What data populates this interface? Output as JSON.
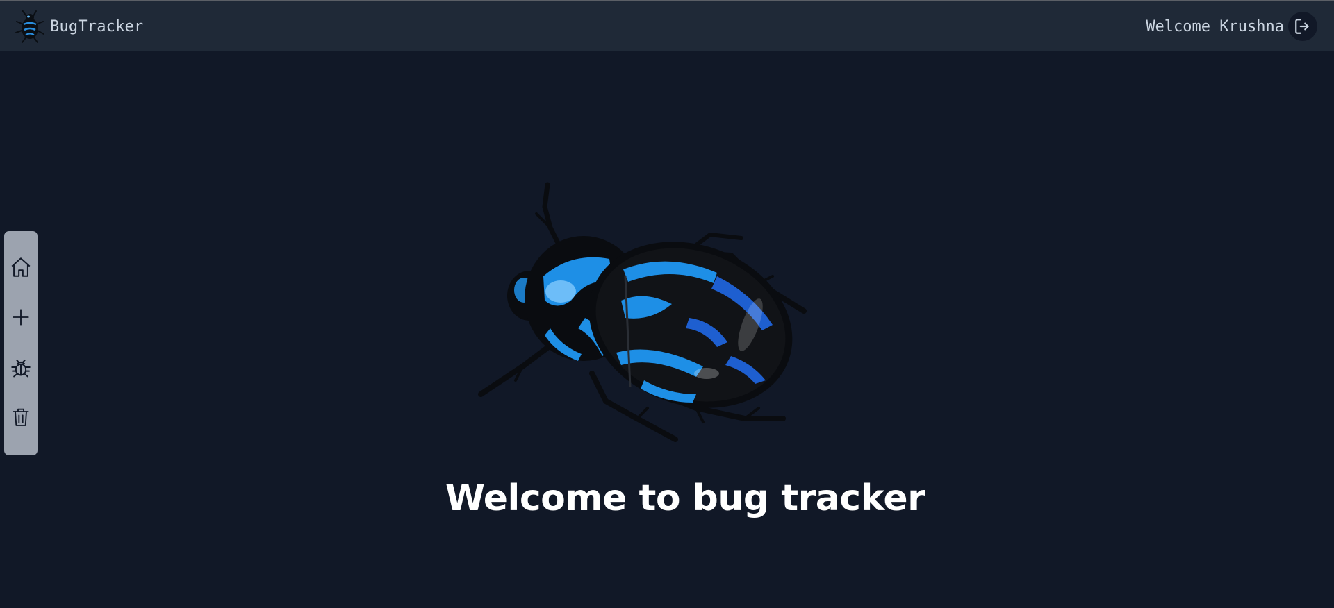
{
  "app": {
    "name": "BugTracker",
    "logo_icon": "beetle-logo-icon"
  },
  "header": {
    "welcome_text": "Welcome Krushna",
    "logout_icon": "logout-icon"
  },
  "sidebar": {
    "items": [
      {
        "id": "home",
        "icon": "home-icon"
      },
      {
        "id": "create",
        "icon": "plus-icon"
      },
      {
        "id": "bugs",
        "icon": "bug-icon"
      },
      {
        "id": "delete",
        "icon": "trash-icon"
      }
    ]
  },
  "main": {
    "hero_image": "blue-beetle-illustration",
    "title": "Welcome to bug tracker"
  },
  "colors": {
    "page_bg": "#111827",
    "navbar_bg": "#1f2937",
    "sidebar_bg": "#9ca3af",
    "accent_blue": "#1e8fe6",
    "text_light": "#cbd5e1"
  }
}
